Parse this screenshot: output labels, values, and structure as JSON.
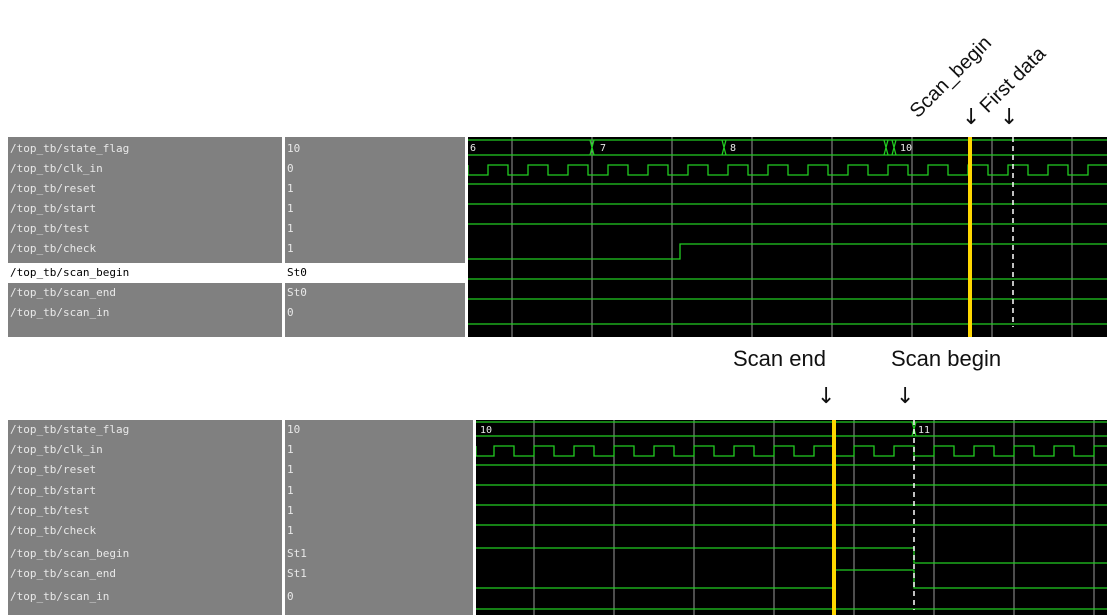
{
  "annotations": {
    "scan_begin_rot": "Scan_begin",
    "first_data": "First data",
    "scan_end": "Scan end",
    "scan_begin": "Scan begin",
    "arrow": "↓"
  },
  "colors": {
    "wave": "#22cc22",
    "cursor": "#ffd700",
    "grid": "#9a9a9a",
    "background": "#000000",
    "panel": "#808080"
  },
  "top_panel": {
    "signals": [
      {
        "name": "/top_tb/state_flag",
        "value": "10"
      },
      {
        "name": "/top_tb/clk_in",
        "value": "0"
      },
      {
        "name": "/top_tb/reset",
        "value": "1"
      },
      {
        "name": "/top_tb/start",
        "value": "1"
      },
      {
        "name": "/top_tb/test",
        "value": "1"
      },
      {
        "name": "/top_tb/check",
        "value": "1"
      },
      {
        "name": "/top_tb/scan_begin",
        "value": "St0"
      },
      {
        "name": "/top_tb/scan_end",
        "value": "St0"
      },
      {
        "name": "/top_tb/scan_in",
        "value": "0"
      }
    ],
    "bus_labels": [
      "6",
      "7",
      "8",
      "10"
    ]
  },
  "bottom_panel": {
    "signals": [
      {
        "name": "/top_tb/state_flag",
        "value": "10"
      },
      {
        "name": "/top_tb/clk_in",
        "value": "1"
      },
      {
        "name": "/top_tb/reset",
        "value": "1"
      },
      {
        "name": "/top_tb/start",
        "value": "1"
      },
      {
        "name": "/top_tb/test",
        "value": "1"
      },
      {
        "name": "/top_tb/check",
        "value": "1"
      },
      {
        "name": "/top_tb/scan_begin",
        "value": "St1"
      },
      {
        "name": "/top_tb/scan_end",
        "value": "St1"
      },
      {
        "name": "/top_tb/scan_in",
        "value": "0"
      }
    ],
    "bus_labels": [
      "10",
      "11"
    ]
  }
}
